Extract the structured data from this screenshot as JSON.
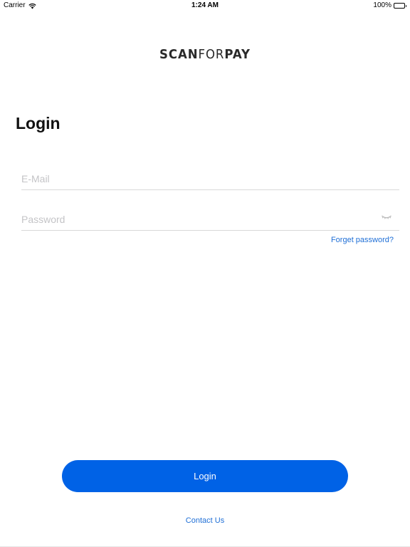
{
  "status_bar": {
    "carrier": "Carrier",
    "time": "1:24 AM",
    "battery": "100%",
    "battery_level": 1.0,
    "wifi_icon": "wifi-icon",
    "battery_icon": "battery-icon"
  },
  "logo": {
    "part1": "SCAN",
    "part2": "FOR",
    "part3": "PAY"
  },
  "login_form": {
    "title": "Login",
    "email": {
      "value": "",
      "placeholder": "E-Mail"
    },
    "password": {
      "value": "",
      "placeholder": "Password",
      "toggle_icon": "eye-closed-icon"
    },
    "forgot_password": "Forget password?",
    "submit_label": "Login"
  },
  "footer": {
    "contact": "Contact Us"
  },
  "colors": {
    "accent": "#0062e6",
    "link": "#1f6fd6",
    "placeholder": "#c4c4c7",
    "divider": "#d9d9d9"
  }
}
